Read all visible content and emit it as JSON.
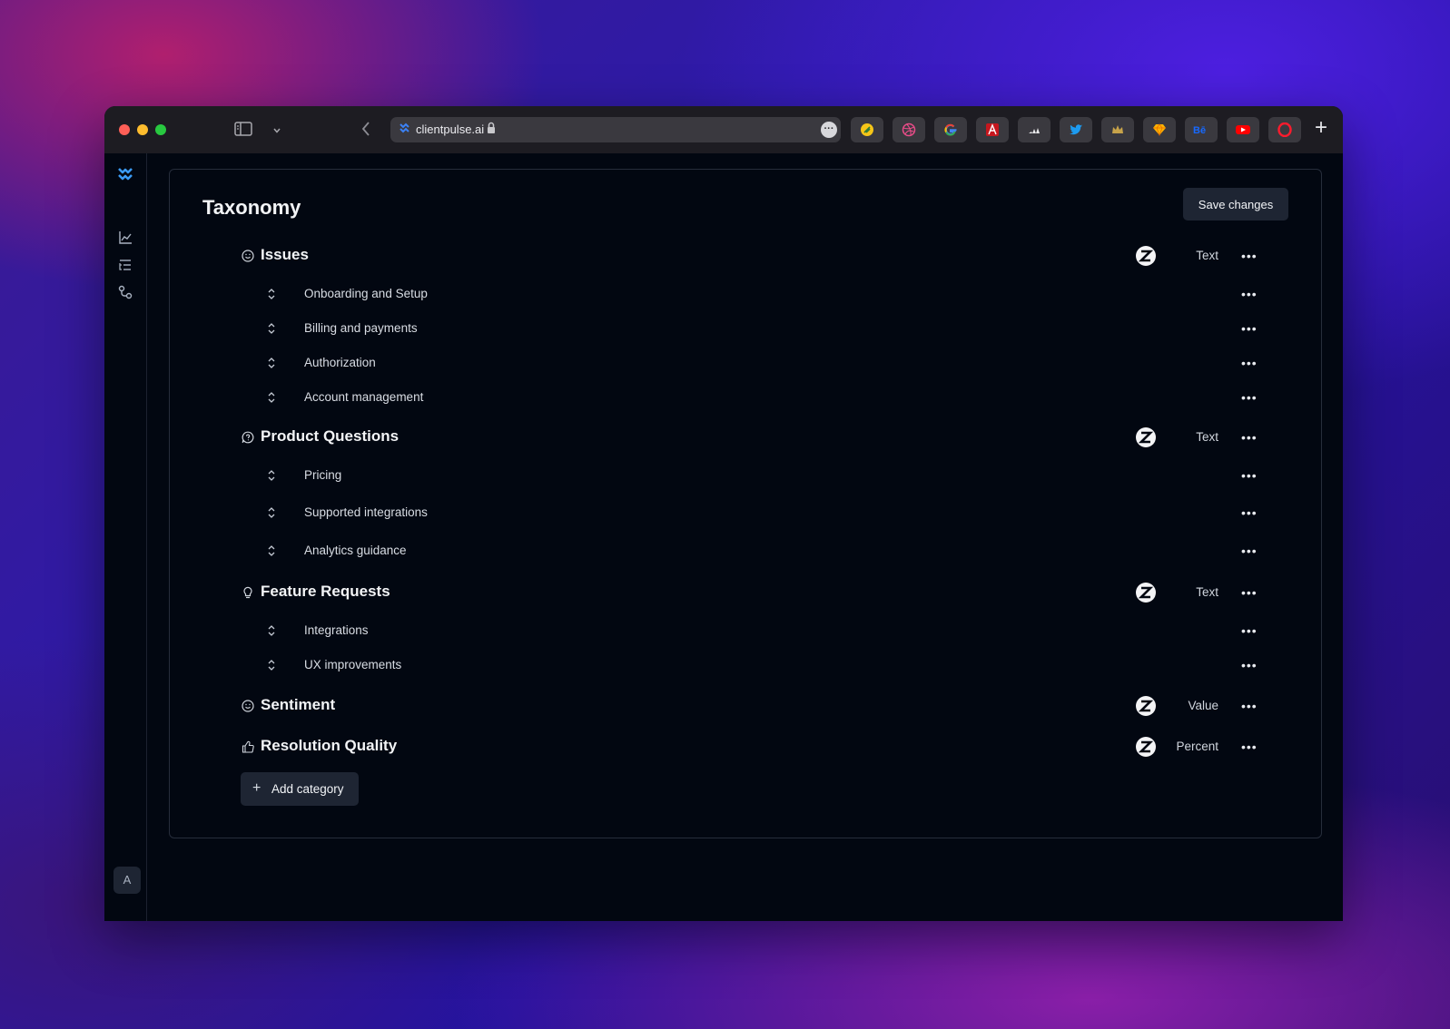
{
  "browser": {
    "url": "clientpulse.ai",
    "extensions": [
      "coin-ext",
      "dribbble-ext",
      "google-ext",
      "adobe-ext",
      "adidas-ext",
      "twitter-ext",
      "crown-ext",
      "sketch-ext",
      "behance-ext",
      "youtube-ext",
      "opera-ext"
    ]
  },
  "sidebar": {
    "items": [
      "logo",
      "analytics",
      "taxonomy",
      "integrations"
    ],
    "avatar_initial": "A"
  },
  "page": {
    "title": "Taxonomy",
    "save_label": "Save changes",
    "add_category_label": "Add category"
  },
  "categories": [
    {
      "name": "Issues",
      "icon": "smile-icon",
      "type": "Text",
      "subcategories": [
        "Onboarding and Setup",
        "Billing and payments",
        "Authorization",
        "Account management"
      ]
    },
    {
      "name": "Product Questions",
      "icon": "chat-question-icon",
      "type": "Text",
      "subcategories": [
        "Pricing",
        "Supported integrations",
        "Analytics guidance"
      ]
    },
    {
      "name": "Feature Requests",
      "icon": "lightbulb-icon",
      "type": "Text",
      "subcategories": [
        "Integrations",
        "UX improvements"
      ]
    },
    {
      "name": "Sentiment",
      "icon": "smile-icon",
      "type": "Value",
      "subcategories": []
    },
    {
      "name": "Resolution Quality",
      "icon": "thumbs-up-icon",
      "type": "Percent",
      "subcategories": []
    }
  ],
  "colors": {
    "accent": "#3b82f6",
    "background": "#020711",
    "button": "#1e2533"
  }
}
